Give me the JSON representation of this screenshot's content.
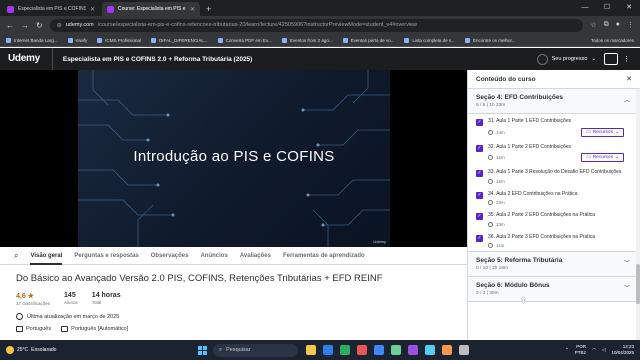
{
  "browser": {
    "tabs": [
      {
        "title": "Especialista em PIS e COFINS 2",
        "active": false
      },
      {
        "title": "Course: Especialista em PIS e C",
        "active": true
      }
    ],
    "url_host": "udemy.com",
    "url_path": "/course/especialista-em-pis-e-cofins-retencoes-tributarias-20/learn/lecture/42505906?instructorPreviewMode=student_v4#overview",
    "bookmarks": [
      "Internet Banda Larg...",
      "Kiwify",
      "ICMS Profissional",
      "DIFAL_DIFERENCIAL...",
      "Converta PDF em Ex...",
      "Eventos from 2 ago...",
      "Eventos perto de vo...",
      "Lista completa de s...",
      "Encontre os melhor..."
    ],
    "bookmarks_all": "Todos os marcadores"
  },
  "header": {
    "logo": "Udemy",
    "course_title": "Especialista em PIS e COFINS 2.0 + Reforma Tributária (2025)",
    "progress_label": "Seu progresso"
  },
  "video": {
    "title": "Introdução ao PIS e COFINS",
    "watermark": "Udemy"
  },
  "course_tabs": [
    "Visão geral",
    "Perguntas e respostas",
    "Observações",
    "Anúncios",
    "Avaliações",
    "Ferramentas de aprendizado"
  ],
  "overview": {
    "title": "Do Básico ao Avançado Versão 2.0 PIS, COFINS, Retenções Tributárias + EFD REINF",
    "rating": "4,6 ★",
    "rating_stars": "★★★★★",
    "rating_label": "37 classificações",
    "students": "145",
    "students_label": "Alunos",
    "hours": "14 horas",
    "hours_label": "Total",
    "last_updated": "Última atualização em março de 2025",
    "language": "Português",
    "captions": "Português [Automático]"
  },
  "sidebar": {
    "title": "Conteúdo do curso",
    "sections": [
      {
        "title": "Seção 4: EFD Contribuições",
        "subtitle": "6 / 6 | 1h 33m",
        "lessons": [
          {
            "title": "31. Aula 1 Parte 1 EFD Contribuições",
            "duration": "14m",
            "resources": "Recursos"
          },
          {
            "title": "32. Aula 1 Parte 2 EFD Contribuições",
            "duration": "16m",
            "resources": "Recursos"
          },
          {
            "title": "33. Aula 1 Parte 3 Resolução do Desafio EFD Contribuições",
            "duration": "15m",
            "resources": ""
          },
          {
            "title": "34. Aula 2 EFD Contribuições na Prática",
            "duration": "23m",
            "resources": ""
          },
          {
            "title": "35. Aula 2 Parte 2 EFD Contribuições na Prática",
            "duration": "13m",
            "resources": ""
          },
          {
            "title": "36. Aula 2 Parte 3 EFD Contribuições na Prática",
            "duration": "11m",
            "resources": ""
          }
        ]
      },
      {
        "title": "Seção 5: Reforma Tributária",
        "subtitle": "0 / 10 | 3h 18m"
      },
      {
        "title": "Seção 6: Módulo Bônus",
        "subtitle": "2 / 2 | 30m"
      }
    ]
  },
  "taskbar": {
    "weather_temp": "25°C",
    "weather_desc": "Ensolarado",
    "search_placeholder": "Pesquisar",
    "lang": "POR",
    "lang2": "PTB2",
    "time": "13:23",
    "date": "10/04/2025"
  }
}
